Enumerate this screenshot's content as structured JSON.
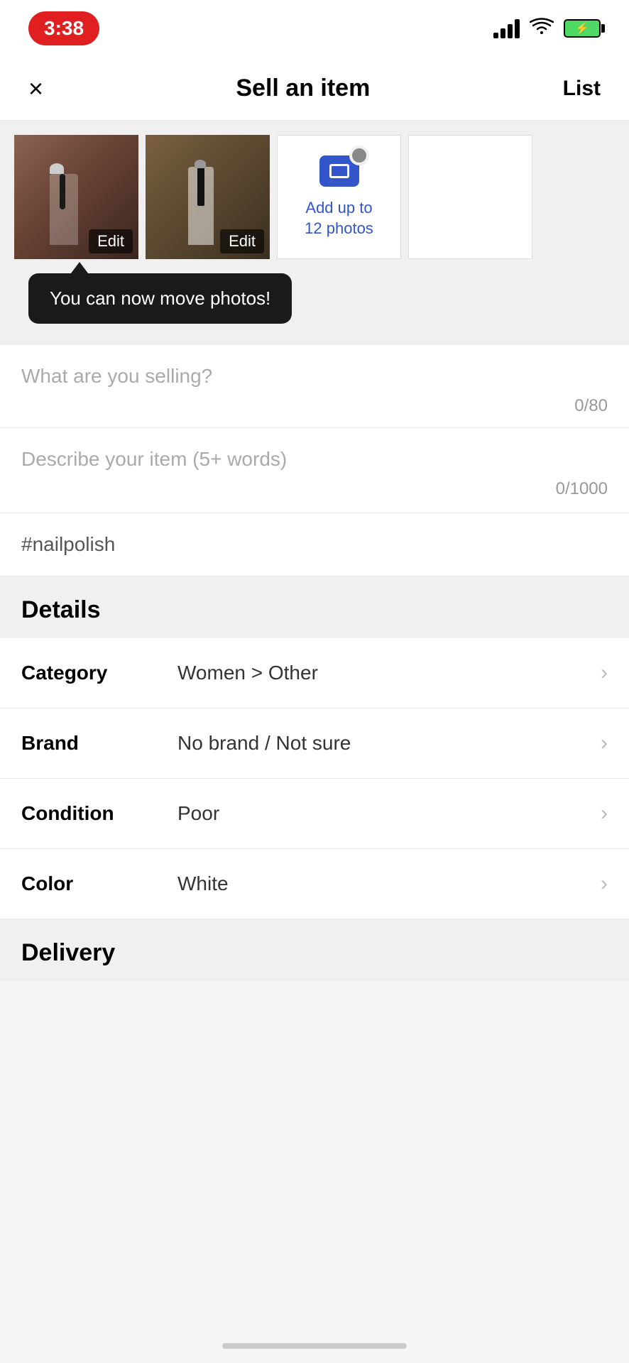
{
  "statusBar": {
    "time": "3:38",
    "batteryLevel": "charging"
  },
  "navBar": {
    "title": "Sell an item",
    "closeLabel": "×",
    "listLabel": "List"
  },
  "photoSection": {
    "photos": [
      {
        "id": 1,
        "editLabel": "Edit",
        "alt": "Nail polish photo 1"
      },
      {
        "id": 2,
        "editLabel": "Edit",
        "alt": "Nail polish photo 2"
      }
    ],
    "addPhotoText": "Add up to\n12 photos",
    "addPhotoLine1": "Add up to",
    "addPhotoLine2": "12 photos"
  },
  "tooltip": {
    "text": "You can now move photos!"
  },
  "form": {
    "titlePlaceholder": "What are you selling?",
    "titleCounter": "0/80",
    "descriptionPlaceholder": "Describe your item (5+ words)",
    "descriptionCounter": "0/1000",
    "hashtag": "#nailpolish"
  },
  "details": {
    "sectionTitle": "Details",
    "fields": [
      {
        "label": "Category",
        "value": "Women > Other"
      },
      {
        "label": "Brand",
        "value": "No brand / Not sure"
      },
      {
        "label": "Condition",
        "value": "Poor"
      },
      {
        "label": "Color",
        "value": "White"
      }
    ]
  },
  "delivery": {
    "sectionTitle": "Delivery"
  },
  "icons": {
    "close": "×",
    "chevronRight": "›"
  }
}
